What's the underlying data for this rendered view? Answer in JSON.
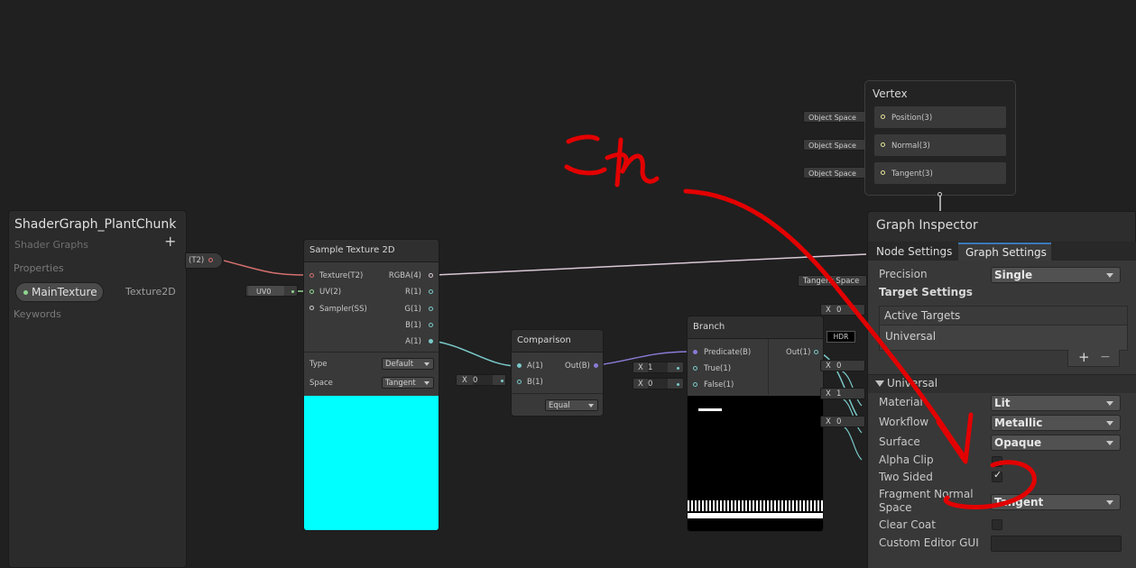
{
  "blackboard": {
    "title": "ShaderGraph_PlantChunk",
    "subtitle": "Shader Graphs",
    "add_glyph": "+",
    "properties_label": "Properties",
    "property": {
      "name": "MainTexture",
      "type": "Texture2D"
    },
    "keywords_label": "Keywords"
  },
  "fragment_node_left": {
    "label": "(T2)"
  },
  "uv_input": {
    "value": "UV0"
  },
  "sample_texture": {
    "title": "Sample Texture 2D",
    "inputs": [
      "Texture(T2)",
      "UV(2)",
      "Sampler(SS)"
    ],
    "outputs": [
      "RGBA(4)",
      "R(1)",
      "G(1)",
      "B(1)",
      "A(1)"
    ],
    "type_label": "Type",
    "type_value": "Default",
    "space_label": "Space",
    "space_value": "Tangent",
    "preview_color": "#00ffff"
  },
  "comparison": {
    "title": "Comparison",
    "inputs": [
      "A(1)",
      "B(1)"
    ],
    "output": "Out(B)",
    "b_field_axis": "X",
    "b_field_value": "0",
    "mode": "Equal"
  },
  "branch": {
    "title": "Branch",
    "inputs": [
      "Predicate(B)",
      "True(1)",
      "False(1)"
    ],
    "output": "Out(1)",
    "true_axis": "X",
    "true_value": "1",
    "false_axis": "X",
    "false_value": "0"
  },
  "vertex": {
    "title": "Vertex",
    "ports": [
      "Position(3)",
      "Normal(3)",
      "Tangent(3)"
    ],
    "space_label": "Object Space"
  },
  "tangent_space": {
    "label": "Tangent Space"
  },
  "right_fields": [
    {
      "axis": "X",
      "value": "0"
    },
    {
      "axis": "X",
      "value": "0"
    },
    {
      "axis": "X",
      "value": "1"
    },
    {
      "axis": "X",
      "value": "0"
    }
  ],
  "hdr_label": "HDR",
  "inspector": {
    "title": "Graph Inspector",
    "tabs": [
      "Node Settings",
      "Graph Settings"
    ],
    "precision_label": "Precision",
    "precision_value": "Single",
    "target_settings": "Target Settings",
    "active_targets": "Active Targets",
    "target_item": "Universal",
    "add_glyph": "+",
    "remove_glyph": "−",
    "section": "Universal",
    "material_label": "Material",
    "material_value": "Lit",
    "workflow_label": "Workflow",
    "workflow_value": "Metallic",
    "surface_label": "Surface",
    "surface_value": "Opaque",
    "alpha_clip_label": "Alpha Clip",
    "two_sided_label": "Two Sided",
    "two_sided_checked": true,
    "fragment_normal_label_1": "Fragment Normal",
    "fragment_normal_label_2": "Space",
    "fragment_normal_value": "Tangent",
    "clear_coat_label": "Clear Coat",
    "custom_editor_label": "Custom Editor GUI"
  },
  "annotation": {
    "text": "これ",
    "color": "#e30000"
  }
}
